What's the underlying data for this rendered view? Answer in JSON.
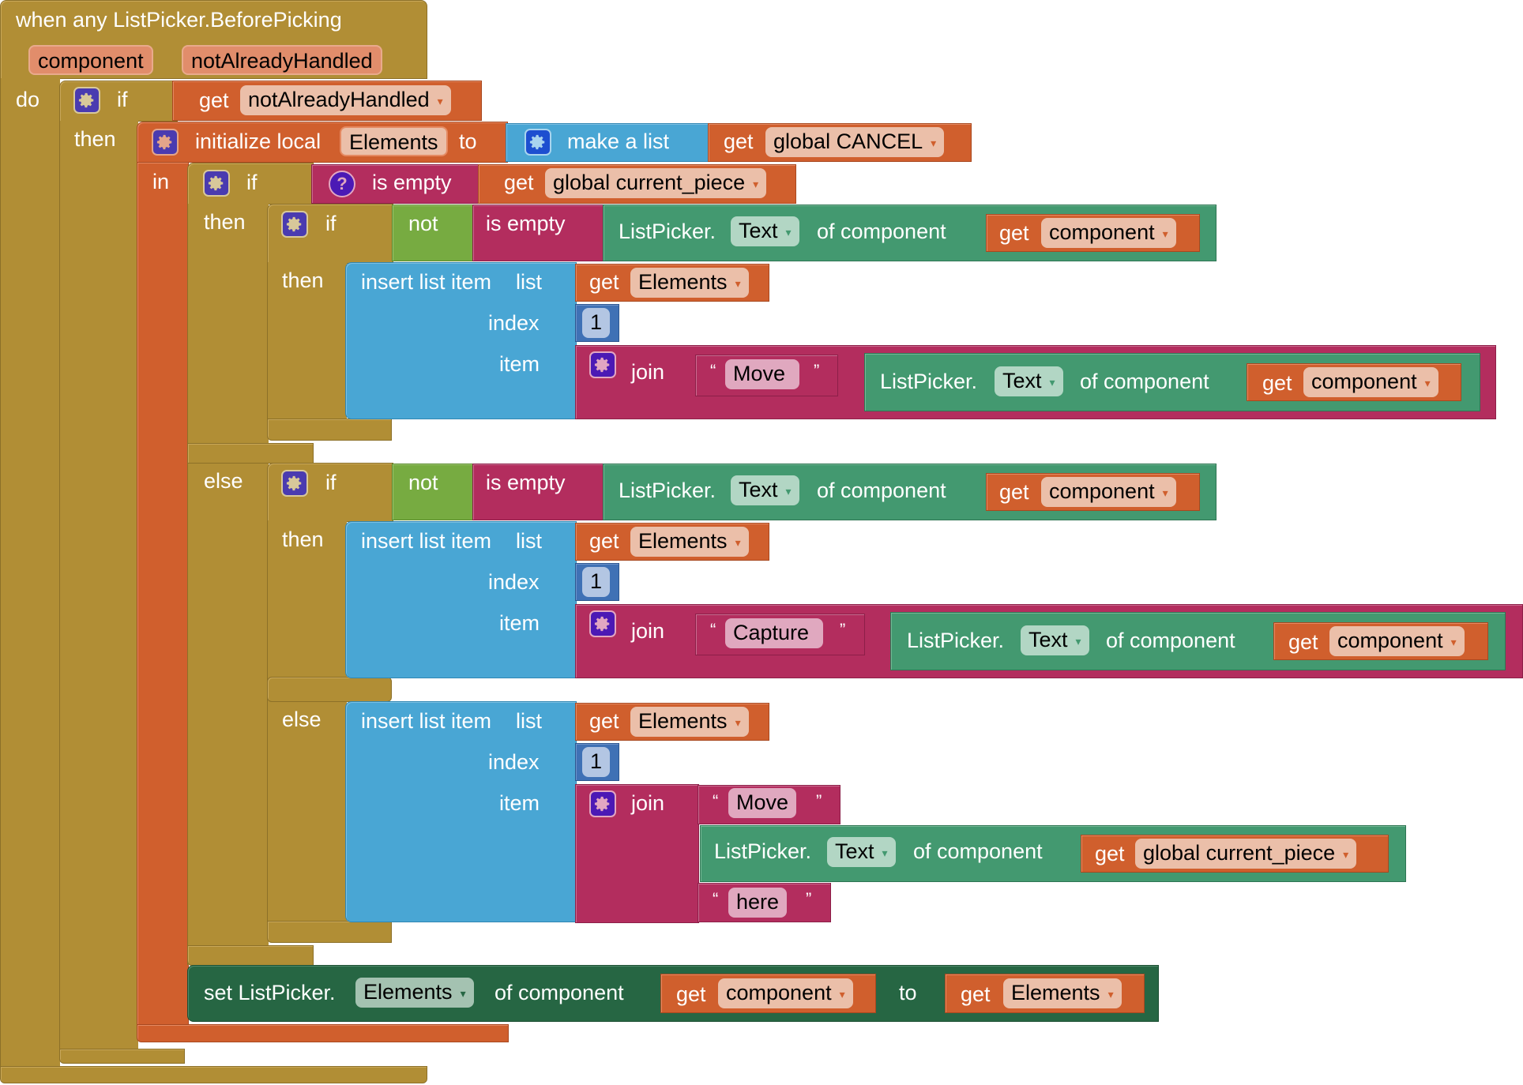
{
  "event": {
    "title": "when any ListPicker.BeforePicking",
    "params": [
      "component",
      "notAlreadyHandled"
    ],
    "do_label": "do"
  },
  "if1": {
    "if_label": "if",
    "then_label": "then",
    "condition": {
      "get": "get",
      "var": "notAlreadyHandled"
    }
  },
  "init_local": {
    "label": "initialize local",
    "var": "Elements",
    "to_label": "to",
    "in_label": "in",
    "make_list": "make a list",
    "item": {
      "get": "get",
      "var": "global CANCEL"
    }
  },
  "if2": {
    "if_label": "if",
    "then_label": "then",
    "else_label": "else",
    "condition": {
      "is_empty": "is empty",
      "get": "get",
      "var": "global current_piece"
    }
  },
  "if3": {
    "if_label": "if",
    "then_label": "then",
    "not_label": "not",
    "is_empty": "is empty",
    "getter": {
      "prefix": "ListPicker.",
      "prop": "Text",
      "of_component": "of component",
      "get": "get",
      "var": "component"
    },
    "insert": {
      "label": "insert list item",
      "list_label": "list",
      "index_label": "index",
      "item_label": "item",
      "list": {
        "get": "get",
        "var": "Elements"
      },
      "index": "1",
      "join": {
        "label": "join",
        "text": "Move ",
        "getter": {
          "prefix": "ListPicker.",
          "prop": "Text",
          "of_component": "of component",
          "get": "get",
          "var": "component"
        }
      }
    }
  },
  "if4": {
    "if_label": "if",
    "then_label": "then",
    "else_label": "else",
    "not_label": "not",
    "is_empty": "is empty",
    "getter": {
      "prefix": "ListPicker.",
      "prop": "Text",
      "of_component": "of component",
      "get": "get",
      "var": "component"
    },
    "insert_then": {
      "label": "insert list item",
      "list_label": "list",
      "index_label": "index",
      "item_label": "item",
      "list": {
        "get": "get",
        "var": "Elements"
      },
      "index": "1",
      "join": {
        "label": "join",
        "text": "Capture ",
        "getter": {
          "prefix": "ListPicker.",
          "prop": "Text",
          "of_component": "of component",
          "get": "get",
          "var": "component"
        }
      }
    },
    "insert_else": {
      "label": "insert list item",
      "list_label": "list",
      "index_label": "index",
      "item_label": "item",
      "list": {
        "get": "get",
        "var": "Elements"
      },
      "index": "1",
      "join": {
        "label": "join",
        "text1": "Move",
        "getter": {
          "prefix": "ListPicker.",
          "prop": "Text",
          "of_component": "of component",
          "get": "get",
          "var": "global current_piece"
        },
        "text2": "here"
      }
    }
  },
  "setter": {
    "prefix": "set ListPicker.",
    "prop": "Elements",
    "of_component": "of component",
    "component": {
      "get": "get",
      "var": "component"
    },
    "to_label": "to",
    "value": {
      "get": "get",
      "var": "Elements"
    }
  },
  "symbols": {
    "open_quote": "“",
    "close_quote": "”",
    "dropdown": "▾",
    "question": "?"
  },
  "colors": {
    "control": "#b18e35",
    "variable": "#d05f2d",
    "list": "#49a6d4",
    "text": "#b32d5e",
    "logic": "#77ab41",
    "component_getter": "#439970",
    "component_setter": "#266643",
    "math": "#3f71b5"
  }
}
